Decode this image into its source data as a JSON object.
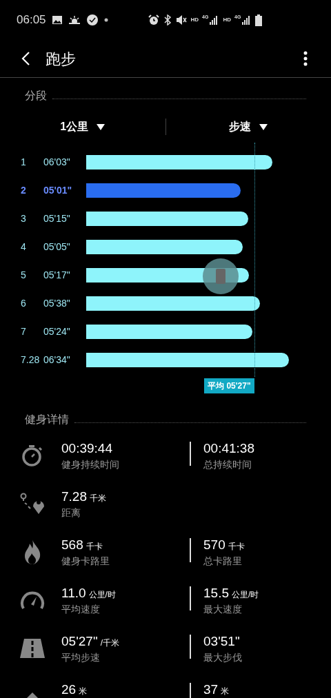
{
  "status_bar": {
    "time": "06:05",
    "networks": [
      {
        "hd": "HD",
        "net": "4G"
      },
      {
        "hd": "HD",
        "net": "4G"
      }
    ]
  },
  "header": {
    "title": "跑步"
  },
  "splits": {
    "title": "分段",
    "selectors": [
      {
        "label": "1公里"
      },
      {
        "label": "步速"
      }
    ],
    "rows": [
      {
        "km": "1",
        "pace": "06'03\"",
        "selected": false
      },
      {
        "km": "2",
        "pace": "05'01\"",
        "selected": true
      },
      {
        "km": "3",
        "pace": "05'15\"",
        "selected": false
      },
      {
        "km": "4",
        "pace": "05'05\"",
        "selected": false
      },
      {
        "km": "5",
        "pace": "05'17\"",
        "selected": false
      },
      {
        "km": "6",
        "pace": "05'38\"",
        "selected": false
      },
      {
        "km": "7",
        "pace": "05'24\"",
        "selected": false
      },
      {
        "km": "7.28",
        "pace": "06'34\"",
        "selected": false
      }
    ],
    "average": {
      "label": "平均 05'27\""
    }
  },
  "details": {
    "title": "健身详情",
    "rows": [
      {
        "left": {
          "value": "00:39:44",
          "label": "健身持续时间"
        },
        "right": {
          "value": "00:41:38",
          "label": "总持续时间"
        }
      },
      {
        "left": {
          "value": "7.28",
          "unit": "千米",
          "label": "距离"
        }
      },
      {
        "left": {
          "value": "568",
          "unit": "千卡",
          "label": "健身卡路里"
        },
        "right": {
          "value": "570",
          "unit": "千卡",
          "label": "总卡路里"
        }
      },
      {
        "left": {
          "value": "11.0",
          "unit": "公里/时",
          "label": "平均速度"
        },
        "right": {
          "value": "15.5",
          "unit": "公里/时",
          "label": "最大速度"
        }
      },
      {
        "left": {
          "value": "05'27\"",
          "unit": "/千米",
          "label": "平均步速"
        },
        "right": {
          "value": "03'51\"",
          "label": "最大步伐"
        }
      },
      {
        "left": {
          "value": "26",
          "unit": "米"
        },
        "right": {
          "value": "37",
          "unit": "米"
        }
      }
    ]
  }
}
